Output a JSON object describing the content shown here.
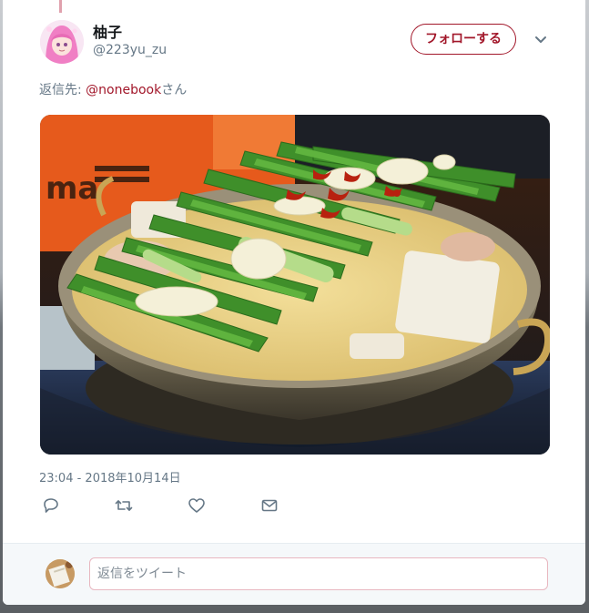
{
  "tweet": {
    "author_name": "柚子",
    "author_handle": "@223yu_zu",
    "follow_label": "フォローする",
    "reply_prefix": "返信先: ",
    "reply_mention": "@nonebook",
    "reply_suffix": "さん",
    "timestamp": "23:04 - 2018年10月14日",
    "photo_sign_text": "ma"
  },
  "reply_box": {
    "placeholder": "返信をツイート",
    "value": ""
  },
  "icons": {
    "reply": "reply-icon",
    "retweet": "retweet-icon",
    "like": "heart-icon",
    "dm": "envelope-icon",
    "more": "chevron-down-icon"
  },
  "colors": {
    "accent": "#a2172a",
    "muted": "#657786",
    "reply_border": "#e8b7c0"
  }
}
